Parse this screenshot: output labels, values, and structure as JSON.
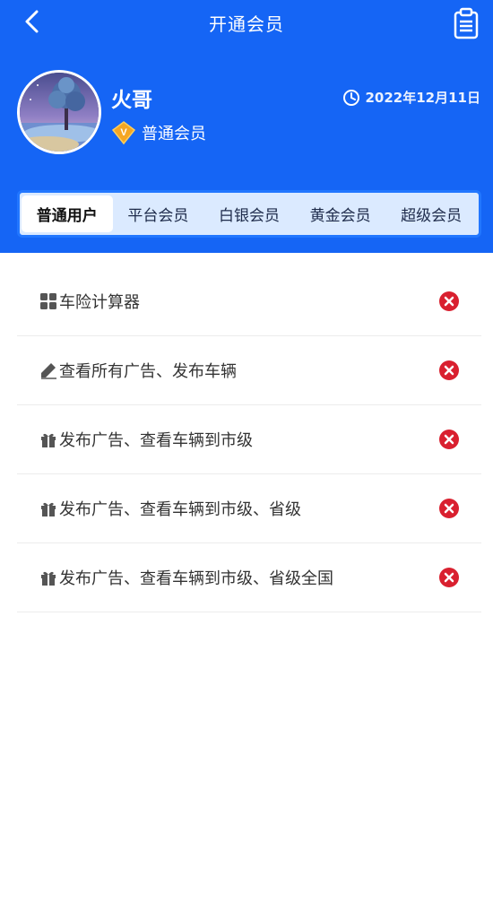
{
  "nav": {
    "title": "开通会员",
    "back_icon": "chevron-left-icon",
    "right_icon": "clipboard-icon"
  },
  "profile": {
    "name": "火哥",
    "level": "普通会员",
    "level_badge": "V",
    "date": "2022年12月11日",
    "avatar_icon": "avatar-landscape-image"
  },
  "tabs": [
    {
      "label": "普通用户",
      "active": true
    },
    {
      "label": "平台会员",
      "active": false
    },
    {
      "label": "白银会员",
      "active": false
    },
    {
      "label": "黄金会员",
      "active": false
    },
    {
      "label": "超级会员",
      "active": false
    }
  ],
  "benefits": [
    {
      "label": "车险计算器",
      "icon": "grid-icon",
      "status": "unavailable"
    },
    {
      "label": "查看所有广告、发布车辆",
      "icon": "pencil-icon",
      "status": "unavailable"
    },
    {
      "label": "发布广告、查看车辆到市级",
      "icon": "gift-icon",
      "status": "unavailable"
    },
    {
      "label": "发布广告、查看车辆到市级、省级",
      "icon": "gift-icon",
      "status": "unavailable"
    },
    {
      "label": "发布广告、查看车辆到市级、省级全国",
      "icon": "gift-icon",
      "status": "unavailable"
    }
  ],
  "colors": {
    "header_bg": "#1565f5",
    "tab_bg": "#dbeaff",
    "vip_badge": "#f5a623",
    "unavailable_icon": "#d9202f"
  }
}
